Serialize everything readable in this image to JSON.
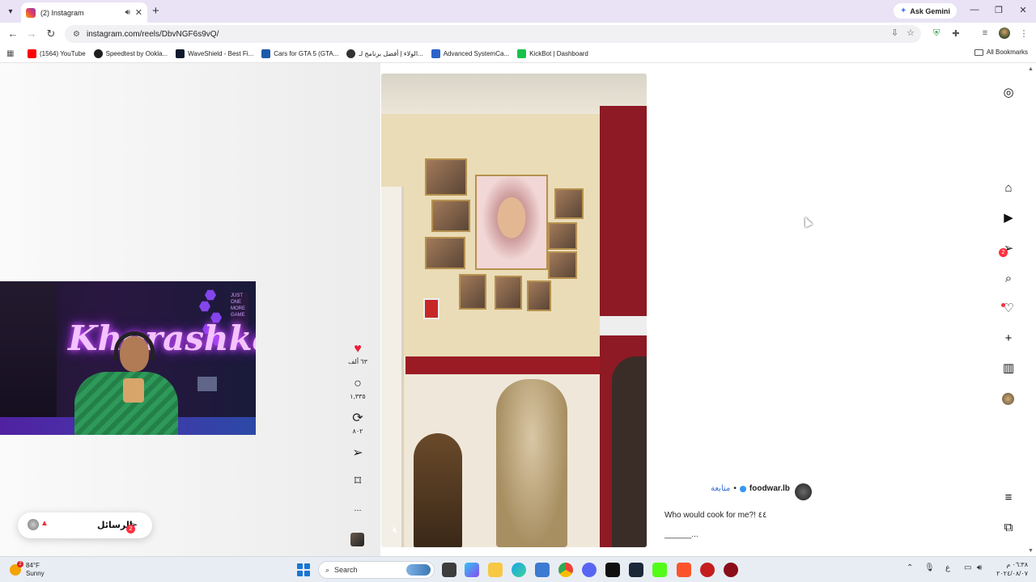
{
  "browser": {
    "tab_title": "(2) Instagram",
    "new_tab": "+",
    "tab_close": "✕",
    "gemini_label": "Ask Gemini",
    "url": "instagram.com/reels/DbvNGF6s9vQ/",
    "bookmarks": [
      {
        "label": "(1564) YouTube",
        "color": "#ff0000"
      },
      {
        "label": "Speedtest by Ookla...",
        "color": "#1e1e1e"
      },
      {
        "label": "WaveShield - Best Fi...",
        "color": "#101a2e"
      },
      {
        "label": "Cars for GTA 5 (GTA...",
        "color": "#1d5aa8"
      },
      {
        "label": "الولاء | أفضل برنامج لـ...",
        "color": "#333333"
      },
      {
        "label": "Advanced SystemCa...",
        "color": "#2a63c9"
      },
      {
        "label": "KickBot | Dashboard",
        "color": "#18c24a"
      }
    ],
    "all_bookmarks": "All Bookmarks"
  },
  "reel": {
    "likes": "٦٣ ألف",
    "comments": "١,٣٣٥",
    "reposts": "٨٠٢",
    "more": "...",
    "username": "foodwar.lb",
    "follow_label": "متابعة",
    "separator": "•",
    "caption": "Who would cook for me?! ٤٤",
    "caption_more": "______..."
  },
  "messages_pill": {
    "label": "الرسائل",
    "badge": "2"
  },
  "sidebar": {
    "messages_badge": "2"
  },
  "webcam": {
    "neon_text": "Khorashka",
    "side_sign": "JUST ONE MORE GAME"
  },
  "taskbar": {
    "weather_temp": "84°F",
    "weather_desc": "Sunny",
    "weather_badge": "2",
    "search_label": "Search",
    "lang": "ع",
    "time": "٠٦:٣٨ م",
    "date": "٢٠٢٤/٠٨/٠٧"
  },
  "colors": {
    "instagram_red": "#ff3040",
    "heart": "#ed1c3a",
    "tabstrip": "#e9e3f5",
    "follow_link": "#3a6fd8"
  }
}
